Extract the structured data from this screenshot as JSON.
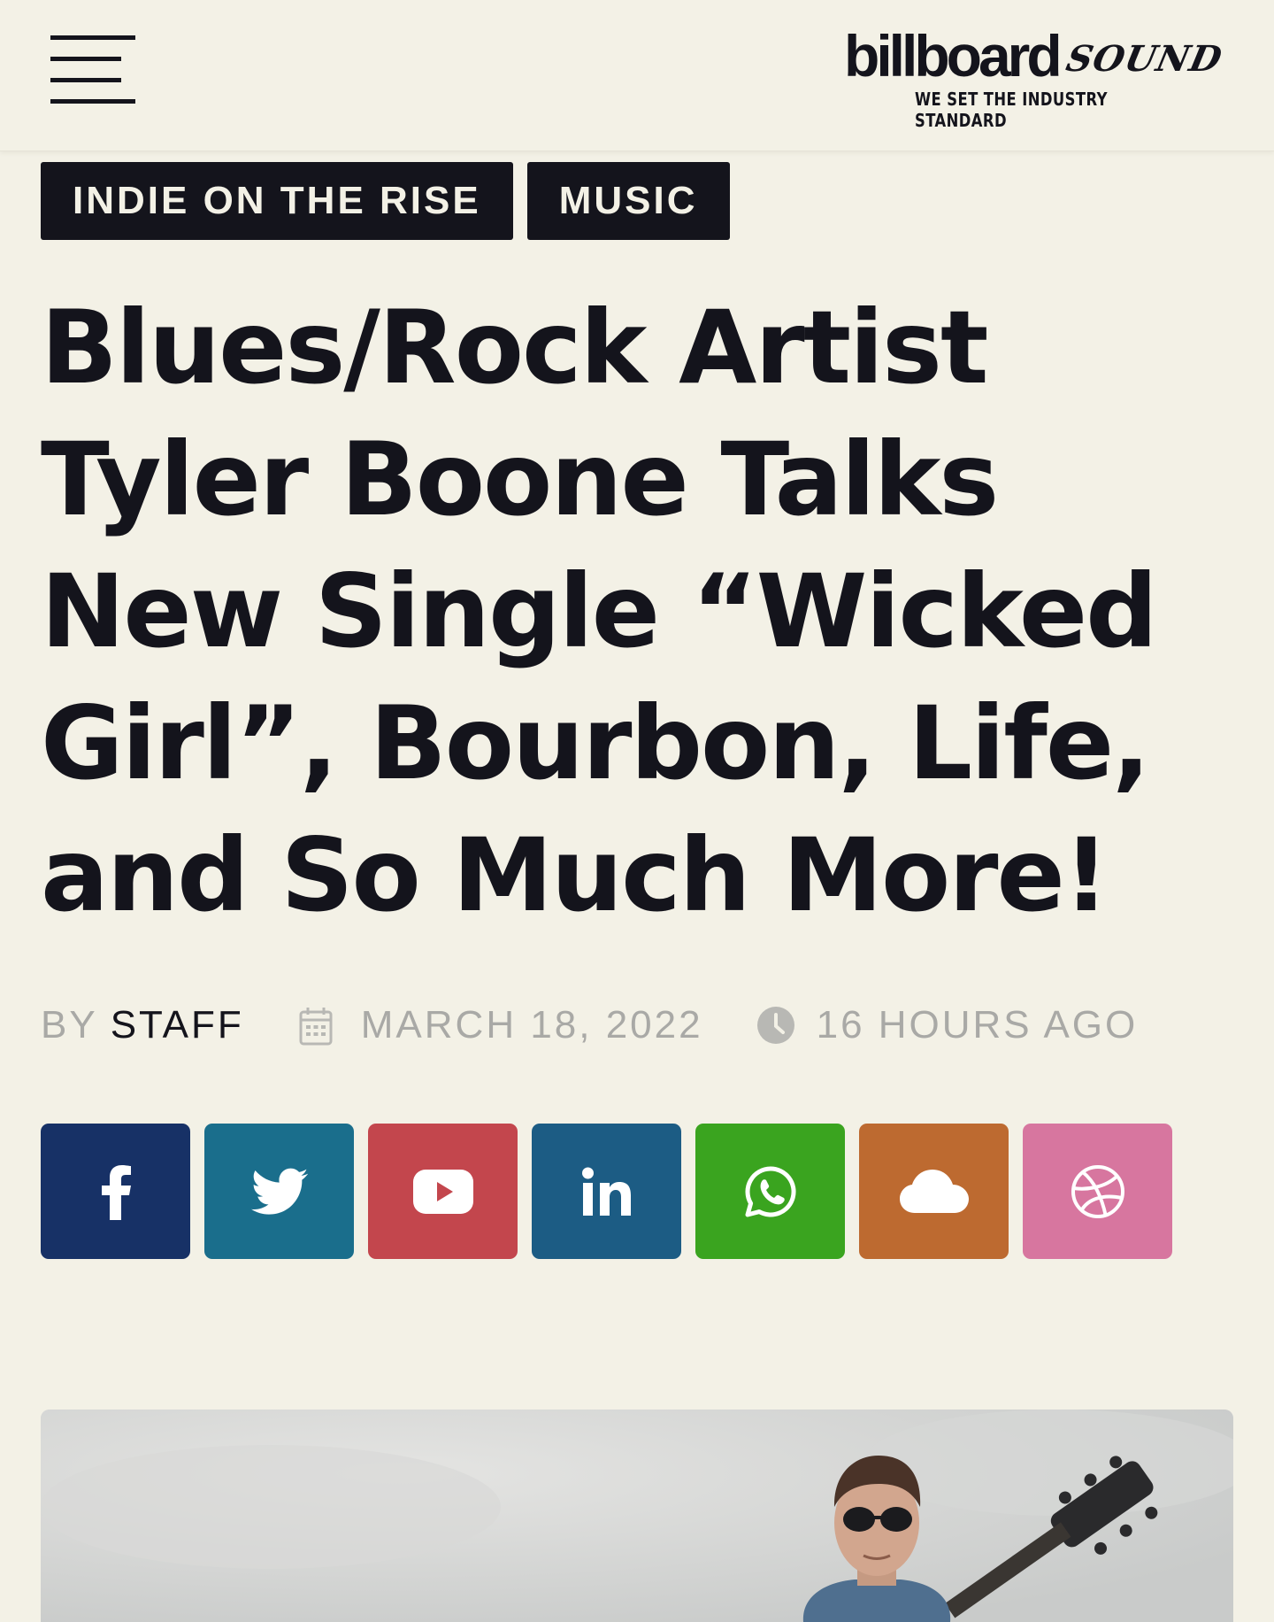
{
  "header": {
    "logo_word": "billboard",
    "logo_script": "SOUND",
    "logo_tagline": "WE SET THE INDUSTRY STANDARD"
  },
  "categories": [
    {
      "label": "INDIE ON THE RISE"
    },
    {
      "label": "MUSIC"
    }
  ],
  "article": {
    "title": "Blues/Rock Artist Tyler Boone Talks New Single “Wicked Girl”, Bourbon, Life, and So Much More!",
    "by_label": "BY",
    "author": "STAFF",
    "date": "MARCH 18, 2022",
    "relative_time": "16 HOURS AGO"
  },
  "social": [
    {
      "name": "facebook",
      "icon": "facebook-icon",
      "color": "#173166"
    },
    {
      "name": "twitter",
      "icon": "twitter-icon",
      "color": "#1a6e8c"
    },
    {
      "name": "youtube",
      "icon": "youtube-icon",
      "color": "#c3464d"
    },
    {
      "name": "linkedin",
      "icon": "linkedin-icon",
      "color": "#1c5c84"
    },
    {
      "name": "whatsapp",
      "icon": "whatsapp-icon",
      "color": "#3aa41f"
    },
    {
      "name": "soundcloud",
      "icon": "cloud-icon",
      "color": "#bd6a30"
    },
    {
      "name": "dribbble",
      "icon": "dribbble-icon",
      "color": "#d7769f"
    }
  ],
  "colors": {
    "background": "#f3f1e6",
    "text": "#14141c",
    "muted": "#a9a9a6"
  }
}
